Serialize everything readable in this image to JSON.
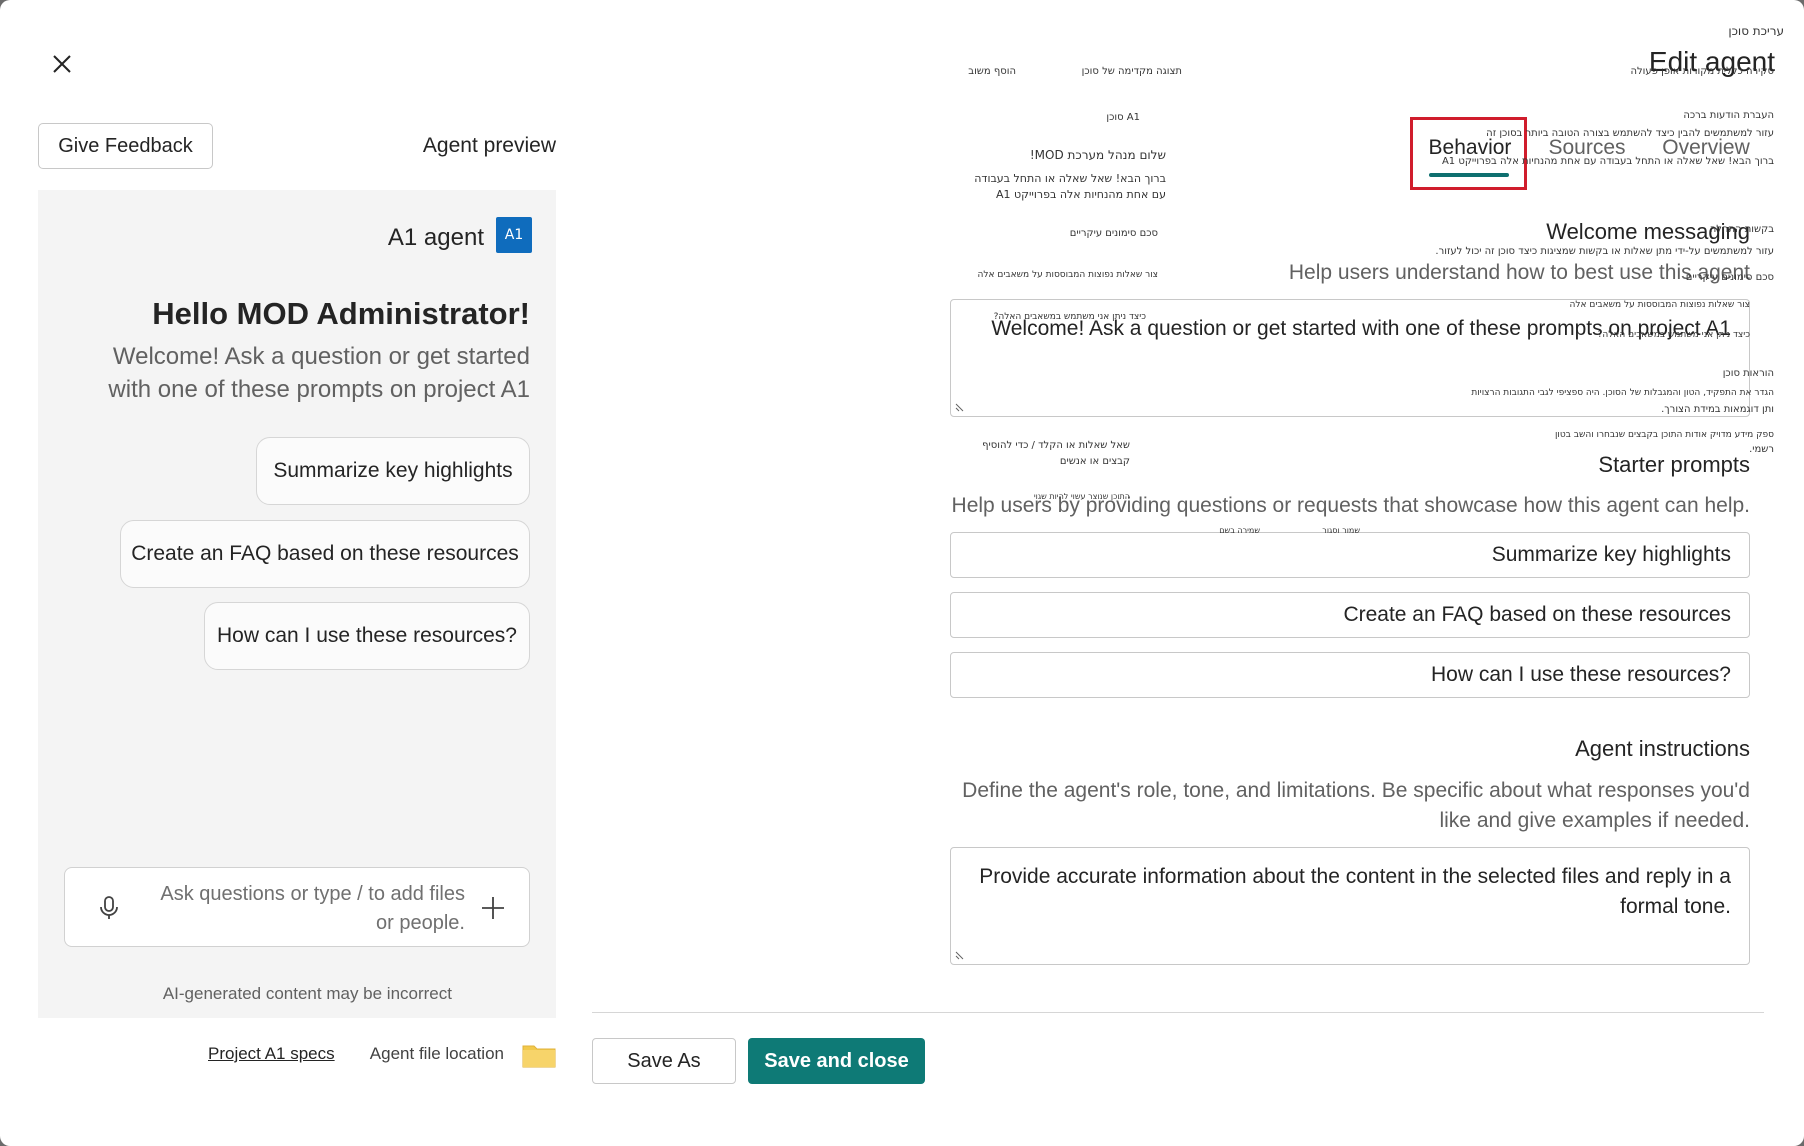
{
  "dialog": {
    "close_icon": "close-icon"
  },
  "preview": {
    "title": "Agent preview",
    "feedback_label": "Give Feedback",
    "agent_avatar": "A1",
    "agent_name": "A1 agent",
    "greeting": "Hello MOD Administrator!",
    "welcome": "Welcome! Ask a question or get started with one of these prompts on project A1",
    "chips": [
      "Summarize key highlights",
      "Create an FAQ based on these resources",
      "How can I use these resources?"
    ],
    "input_placeholder": "Ask questions or type / to add files or people.",
    "disclaimer": "AI-generated content may be incorrect",
    "file_location_label": "Agent file location",
    "file_link": "Project A1 specs"
  },
  "editor": {
    "title": "Edit agent",
    "tabs": [
      "Overview",
      "Sources",
      "Behavior"
    ],
    "active_tab": "Behavior",
    "welcome_title": "Welcome messaging",
    "welcome_desc": "Help users understand how to best use this agent",
    "welcome_value": "Welcome! Ask a question or get started with one of these prompts on project A1",
    "starter_title": "Starter prompts",
    "starter_desc": "Help users by providing questions or requests that showcase how this agent can help.",
    "starter_prompts": [
      "Summarize key highlights",
      "Create an FAQ based on these resources",
      "How can I use these resources?"
    ],
    "instructions_title": "Agent instructions",
    "instructions_desc": "Define the agent's role, tone, and limitations. Be specific about what responses you'd like and give examples if needed.",
    "instructions_value": "Provide accurate information about the content in the selected files and reply in a formal tone.",
    "save_close_label": "Save and close",
    "save_as_label": "Save As"
  },
  "overlay_hebrew": {
    "edit_agent": "עריכת סוכן",
    "tabs_row": "סקירה כללית   מקורות   אופן פעולה",
    "preview_header": "תצוגה מקדימה של סוכן",
    "add_feedback": "הוסף משוב",
    "welcome_messages": "העברת הודעות ברכה",
    "welcome_help": "עזור למשתמשים להבין כיצד להשתמש בצורה הטובה ביותר בסוכן זה",
    "welcome_text_small": "ברוך הבא! שאל שאלה או התחל בעבודה עם אחת מהנחיות אלה בפרוייקט A1",
    "agent_label": "A1 סוכן",
    "hello_admin": "שלום   מנהל מערכת MOD!",
    "welcome_line1": "ברוך הבא! שאל שאלה או התחל בעבודה",
    "welcome_line2": "עם אחת מהנחיות אלה בפרוייקט A1",
    "summarize": "סכם סימונים עיקריים",
    "faq": "צור שאלות נפוצות המבוססות על משאבים אלה",
    "how_use": "כיצד ניתן   אני משתמש במשאבים האלה?",
    "starter_request": "בקשות התחלה",
    "starter_help": "עזור למשתמשים על-ידי מתן שאלות או בקשות שמציגות כיצד סוכן זה יכול לעזור.",
    "summarize_r": "סכם סימונים עיקריים",
    "faq_r": "צור שאלות נפוצות המבוססות על משאבים אלה",
    "how_use_r": "כיצד ניתן   אני משתמש במשאבים האלה?",
    "instructions": "הוראות סוכן",
    "instructions_help": "הגדר את התפקיד, הטון והמגבלות של הסוכן. היה ספציפי לגבי התגובות הרצויות",
    "instructions_help2": "ותן דוגמאות במידת הצורך.",
    "instructions_value": "ספק מידע מדויק אודות התוכן בקבצים שנבחרו והשב בטון",
    "instructions_value2": "רשמי.",
    "ask_add": "שאל שאלות או הקלד / כדי להוסיף",
    "ask_add2": "קבצים או אנשים",
    "ai_generated": "התוכן שנוצר עשוי להיות שגוי",
    "save_close": "שמור וסגור",
    "save_as": "שמירה בשם"
  }
}
